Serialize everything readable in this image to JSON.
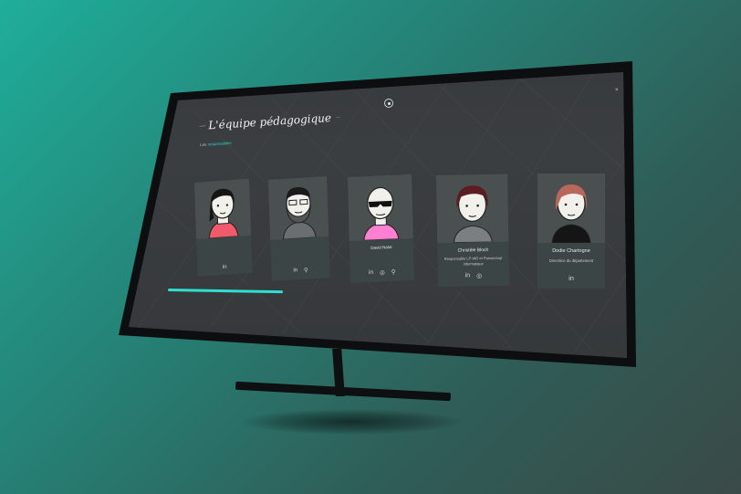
{
  "page": {
    "top_label": "",
    "title": "L'équipe pédagogique",
    "close_label": "×",
    "footer_text": ""
  },
  "intro": {
    "paragraph_1_prefix": "Les",
    "paragraph_1_highlight": "responsables",
    "paragraph_1_suffix": "",
    "paragraph_2_prefix": "",
    "paragraph_2_highlight": "",
    "paragraph_2_suffix": ""
  },
  "team": [
    {
      "name": "",
      "role": "",
      "socials": [
        "linkedin-icon"
      ]
    },
    {
      "name": "",
      "role": "",
      "socials": [
        "linkedin-icon",
        "github-icon"
      ]
    },
    {
      "name": "David Nalut",
      "role": "",
      "socials": [
        "linkedin-icon",
        "instagram-icon",
        "github-icon"
      ]
    },
    {
      "name": "Christèle Bloch",
      "role": "Responsable LP-WD et Parcoursup informatique",
      "socials": [
        "linkedin-icon",
        "instagram-icon"
      ]
    },
    {
      "name": "Dodie Chartogne",
      "role": "Directrice du département",
      "socials": [
        "linkedin-icon"
      ]
    }
  ],
  "progress": {
    "fraction": 0.25
  },
  "colors": {
    "accent": "#2ee0d0",
    "screen_bg": "#3b3e40",
    "card_bg": "#3c4545"
  }
}
